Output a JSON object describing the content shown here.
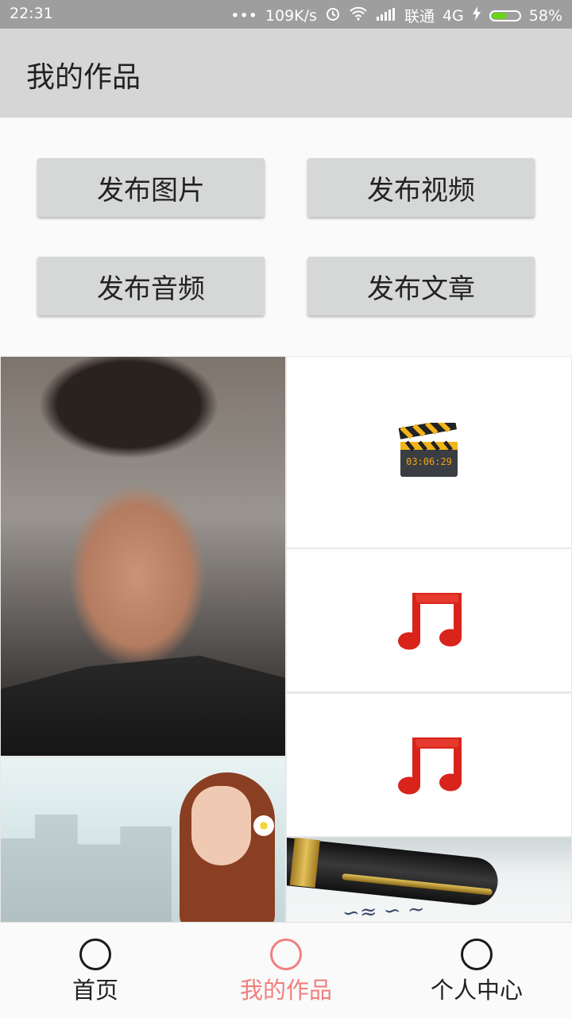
{
  "status_bar": {
    "time": "22:31",
    "dots": "•••",
    "speed": "109K/s",
    "carrier": "联通",
    "network": "4G",
    "battery_percent": "58%",
    "battery_level": 0.58,
    "icons": [
      "alarm-icon",
      "wifi-icon",
      "signal-icon",
      "charging-icon",
      "battery-icon"
    ]
  },
  "app_bar": {
    "title": "我的作品"
  },
  "actions": {
    "publish_image": "发布图片",
    "publish_video": "发布视频",
    "publish_audio": "发布音频",
    "publish_article": "发布文章"
  },
  "works": {
    "items": [
      {
        "type": "image",
        "icon": "man-portrait-photo"
      },
      {
        "type": "video",
        "icon": "clapperboard-icon",
        "timer_text": "03:06:29"
      },
      {
        "type": "audio",
        "icon": "music-note-icon"
      },
      {
        "type": "audio",
        "icon": "music-note-icon"
      },
      {
        "type": "image",
        "icon": "woman-portrait-photo"
      },
      {
        "type": "image",
        "icon": "pen-letter-photo"
      }
    ]
  },
  "bottom_nav": {
    "items": [
      {
        "label": "首页",
        "icon": "circle-icon",
        "active": false
      },
      {
        "label": "我的作品",
        "icon": "circle-icon",
        "active": true
      },
      {
        "label": "个人中心",
        "icon": "circle-icon",
        "active": false
      }
    ],
    "active_color": "#f08080",
    "inactive_color": "#222222"
  }
}
